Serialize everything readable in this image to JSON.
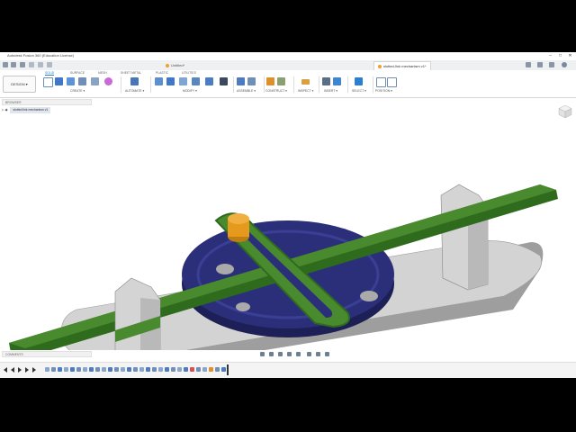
{
  "window": {
    "title": "Autodesk Fusion 360 (Education License)",
    "controls": [
      "–",
      "□",
      "✕"
    ]
  },
  "tabs": [
    {
      "label": "Untitled*",
      "active": false
    },
    {
      "label": "slotted-link mechanism v1*",
      "active": true
    }
  ],
  "toolbar": {
    "workspace": "DESIGN ▾",
    "workspace_tabs": [
      "SOLID",
      "SURFACE",
      "MESH",
      "SHEET METAL",
      "PLASTIC",
      "UTILITIES"
    ],
    "active_tab": "SOLID",
    "groups": [
      {
        "label": "CREATE ▾",
        "icons": [
          "sketch-icon",
          "box-icon",
          "extrude-icon",
          "revolve-icon",
          "hole-icon",
          "sphere-icon"
        ]
      },
      {
        "label": "AUTOMATE ▾",
        "icons": [
          "automate-icon"
        ]
      },
      {
        "label": "MODIFY ▾",
        "icons": [
          "press-pull-icon",
          "fillet-icon",
          "chamfer-icon",
          "shell-icon",
          "combine-icon",
          "move-icon"
        ]
      },
      {
        "label": "ASSEMBLE ▾",
        "icons": [
          "new-component-icon",
          "joint-icon"
        ]
      },
      {
        "label": "CONSTRUCT ▾",
        "icons": [
          "offset-plane-icon",
          "midplane-icon"
        ]
      },
      {
        "label": "INSPECT ▾",
        "icons": [
          "measure-icon"
        ]
      },
      {
        "label": "INSERT ▾",
        "icons": [
          "insert-derive-icon",
          "insert-image-icon"
        ]
      },
      {
        "label": "SELECT ▾",
        "icons": [
          "select-icon"
        ]
      },
      {
        "label": "POSITION ▾",
        "icons": [
          "capture-position-icon"
        ]
      }
    ]
  },
  "browser": {
    "header": "BROWSER",
    "root_item": "slotted link mechanism v1"
  },
  "comments": {
    "label": "COMMENTS"
  },
  "model": {
    "colors": {
      "base": "#d3d3d3",
      "disc": "#2b2f7a",
      "slider": "#4a8a2e",
      "pin": "#e59a1e"
    }
  },
  "colors": {
    "accent": "#2a7fd0",
    "toolbar_bg": "#ffffff",
    "tab_bg": "#eef0f2"
  }
}
